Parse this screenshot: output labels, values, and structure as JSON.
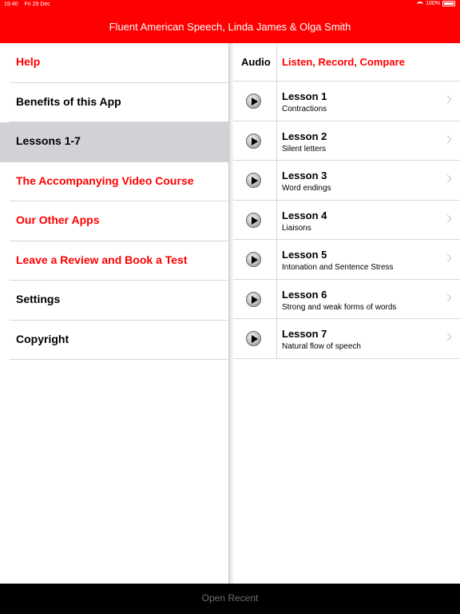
{
  "status_bar": {
    "time": "19:40",
    "date": "Fri 29 Dec",
    "battery": "100%"
  },
  "header": {
    "title": "Fluent American Speech, Linda James & Olga Smith"
  },
  "menu": {
    "items": [
      {
        "label": "Help",
        "color": "#ff0000",
        "selected": false
      },
      {
        "label": "Benefits of this App",
        "color": "#000000",
        "selected": false
      },
      {
        "label": "Lessons 1-7",
        "color": "#000000",
        "selected": true
      },
      {
        "label": "The Accompanying Video Course",
        "color": "#ff0000",
        "selected": false
      },
      {
        "label": "Our Other Apps",
        "color": "#ff0000",
        "selected": false
      },
      {
        "label": "Leave a Review and Book a Test",
        "color": "#ff0000",
        "selected": false
      },
      {
        "label": "Settings",
        "color": "#000000",
        "selected": false
      },
      {
        "label": "Copyright",
        "color": "#000000",
        "selected": false
      }
    ]
  },
  "lessons_panel": {
    "audio_header": "Audio",
    "section_header": "Listen, Record, Compare",
    "lessons": [
      {
        "title": "Lesson 1",
        "subtitle": "Contractions"
      },
      {
        "title": "Lesson 2",
        "subtitle": "Silent letters"
      },
      {
        "title": "Lesson 3",
        "subtitle": "Word endings"
      },
      {
        "title": "Lesson 4",
        "subtitle": "Liaisons"
      },
      {
        "title": "Lesson 5",
        "subtitle": "Intonation and Sentence Stress"
      },
      {
        "title": "Lesson 6",
        "subtitle": "Strong and weak forms of words"
      },
      {
        "title": "Lesson 7",
        "subtitle": "Natural flow of speech"
      }
    ]
  },
  "bottom_bar": {
    "open_recent_label": "Open Recent"
  },
  "colors": {
    "accent": "#ff0000",
    "selected_row": "#d1d1d6",
    "bottom_bar": "#000000"
  }
}
